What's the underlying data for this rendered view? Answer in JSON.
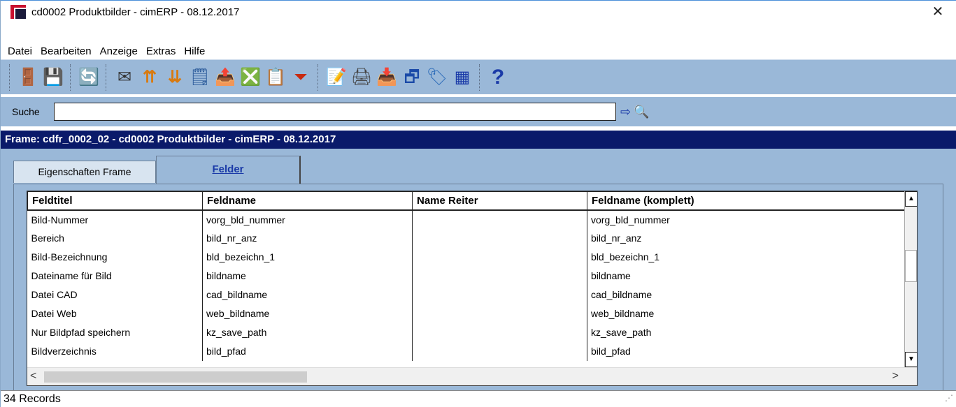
{
  "window": {
    "title": "cd0002 Produktbilder - cimERP - 08.12.2017",
    "close": "✕"
  },
  "menu": [
    "Datei",
    "Bearbeiten",
    "Anzeige",
    "Extras",
    "Hilfe"
  ],
  "toolbar": {
    "icons": [
      {
        "name": "exit-door-icon",
        "glyph": "🚪"
      },
      {
        "name": "save-icon",
        "glyph": "💾"
      },
      {
        "name": "refresh-icon",
        "glyph": "🔄"
      },
      {
        "name": "email-icon",
        "glyph": "✉"
      },
      {
        "name": "sort-ascending-icon",
        "glyph": "⇈"
      },
      {
        "name": "sort-descending-icon",
        "glyph": "⇊"
      },
      {
        "name": "number-list-icon",
        "glyph": "🗒"
      },
      {
        "name": "export-icon",
        "glyph": "📤"
      },
      {
        "name": "excel-icon",
        "glyph": "❎"
      },
      {
        "name": "copy-icon",
        "glyph": "📋"
      },
      {
        "name": "filter-icon",
        "glyph": "⏷"
      },
      {
        "name": "properties-icon",
        "glyph": "📝"
      },
      {
        "name": "print-icon",
        "glyph": "🖨"
      },
      {
        "name": "import-icon",
        "glyph": "📥"
      },
      {
        "name": "windows-icon",
        "glyph": "🗗"
      },
      {
        "name": "tag-icon",
        "glyph": "🏷"
      },
      {
        "name": "grid-icon",
        "glyph": "▦"
      },
      {
        "name": "help-icon",
        "glyph": "?"
      }
    ]
  },
  "search": {
    "label": "Suche",
    "value": "",
    "go_icon": "⇨",
    "find_icon": "🔍"
  },
  "frame_header": "Frame: cdfr_0002_02 - cd0002 Produktbilder - cimERP - 08.12.2017",
  "tabs": [
    {
      "label": "Eigenschaften Frame",
      "active": false
    },
    {
      "label": "Felder",
      "active": true
    }
  ],
  "grid": {
    "columns": [
      "Feldtitel",
      "Feldname",
      "Name Reiter",
      "Feldname (komplett)"
    ],
    "rows": [
      [
        "Bild-Nummer",
        "vorg_bld_nummer",
        "",
        "vorg_bld_nummer"
      ],
      [
        "Bereich",
        "bild_nr_anz",
        "",
        "bild_nr_anz"
      ],
      [
        "Bild-Bezeichnung",
        "bld_bezeichn_1",
        "",
        "bld_bezeichn_1"
      ],
      [
        "Dateiname für Bild",
        "bildname",
        "",
        "bildname"
      ],
      [
        "Datei CAD",
        "cad_bildname",
        "",
        "cad_bildname"
      ],
      [
        "Datei Web",
        "web_bildname",
        "",
        "web_bildname"
      ],
      [
        "Nur Bildpfad speichern",
        "kz_save_path",
        "",
        "kz_save_path"
      ],
      [
        "Bildverzeichnis",
        "bild_pfad",
        "",
        "bild_pfad"
      ]
    ]
  },
  "status": {
    "records": "34 Records"
  }
}
